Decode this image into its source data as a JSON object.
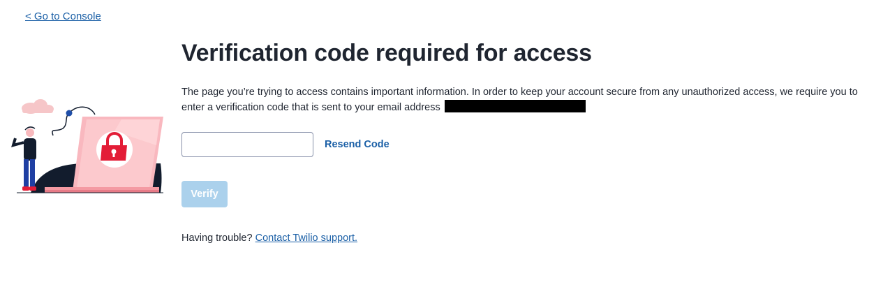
{
  "nav": {
    "back_label": "< Go to Console"
  },
  "main": {
    "title": "Verification code required for access",
    "description": "The page you’re trying to access contains important information. In order to keep your account secure from any unauthorized access, we require you to enter a verification code that is sent to your email address",
    "email_redacted": true
  },
  "form": {
    "code_input_value": "",
    "code_input_placeholder": "",
    "resend_label": "Resend Code",
    "verify_label": "Verify"
  },
  "footer": {
    "help_prefix": "Having trouble?",
    "help_link": "Contact Twilio support."
  },
  "illustration": {
    "icon": "laptop-lock-illustration"
  },
  "colors": {
    "link": "#1a5fa6",
    "verify_disabled_bg": "#abd1ec",
    "laptop_pink": "#f9b8bf",
    "lock_red": "#e31d37",
    "navy": "#121c2d"
  }
}
